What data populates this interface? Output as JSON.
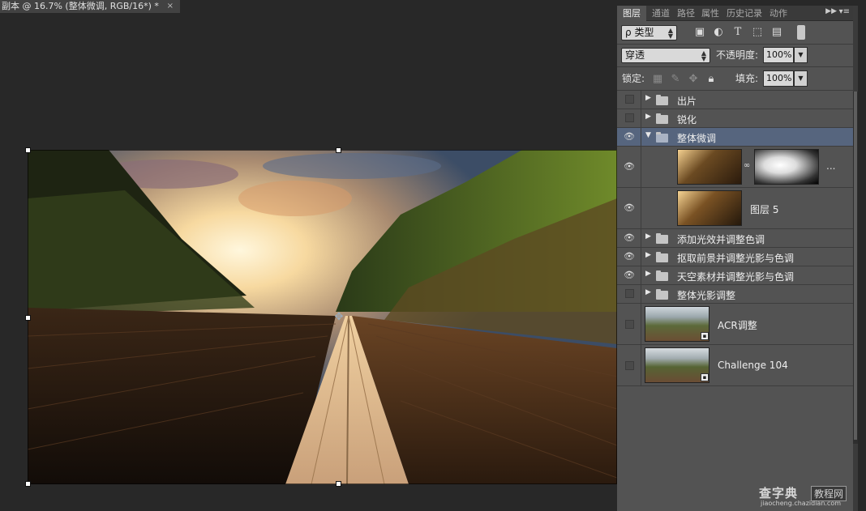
{
  "document_tab": {
    "title": "副本 @ 16.7% (整体微调, RGB/16*) *",
    "close": "×"
  },
  "panel": {
    "tabs": [
      "图层",
      "通道",
      "路径",
      "属性",
      "历史记录",
      "动作"
    ],
    "active_tab": "图层",
    "menu_glyph": "▸▸ ▾≡"
  },
  "filter": {
    "kind_label": "类型",
    "search_glyph": "ρ"
  },
  "blend": {
    "mode": "穿透",
    "opacity_label": "不透明度:",
    "opacity_value": "100%"
  },
  "lock": {
    "label": "锁定:",
    "fill_label": "填充:",
    "fill_value": "100%"
  },
  "layers": [
    {
      "name": "出片",
      "type": "group",
      "visible": false,
      "expanded": false
    },
    {
      "name": "锐化",
      "type": "group",
      "visible": false,
      "expanded": false
    },
    {
      "name": "整体微调",
      "type": "group",
      "visible": true,
      "expanded": true,
      "selected": true
    },
    {
      "name": "",
      "type": "adjustment-with-mask",
      "visible": true,
      "more": "..."
    },
    {
      "name": "图层 5",
      "type": "pixel",
      "visible": true
    },
    {
      "name": "添加光效并调整色调",
      "type": "group",
      "visible": true,
      "expanded": false
    },
    {
      "name": "抠取前景并调整光影与色调",
      "type": "group",
      "visible": true,
      "expanded": false
    },
    {
      "name": "天空素材并调整光影与色调",
      "type": "group",
      "visible": true,
      "expanded": false
    },
    {
      "name": "整体光影调整",
      "type": "group",
      "visible": false,
      "expanded": false
    },
    {
      "name": "ACR调整",
      "type": "smart-object",
      "visible": false
    },
    {
      "name": "Challenge 104",
      "type": "smart-object",
      "visible": false
    }
  ],
  "watermark": {
    "title": "查字典",
    "badge": "教程网",
    "url": "jiaocheng.chazidian.com"
  },
  "colors": {
    "selected_layer": "#56657e",
    "panel_bg": "#535353",
    "app_bg": "#282828"
  }
}
